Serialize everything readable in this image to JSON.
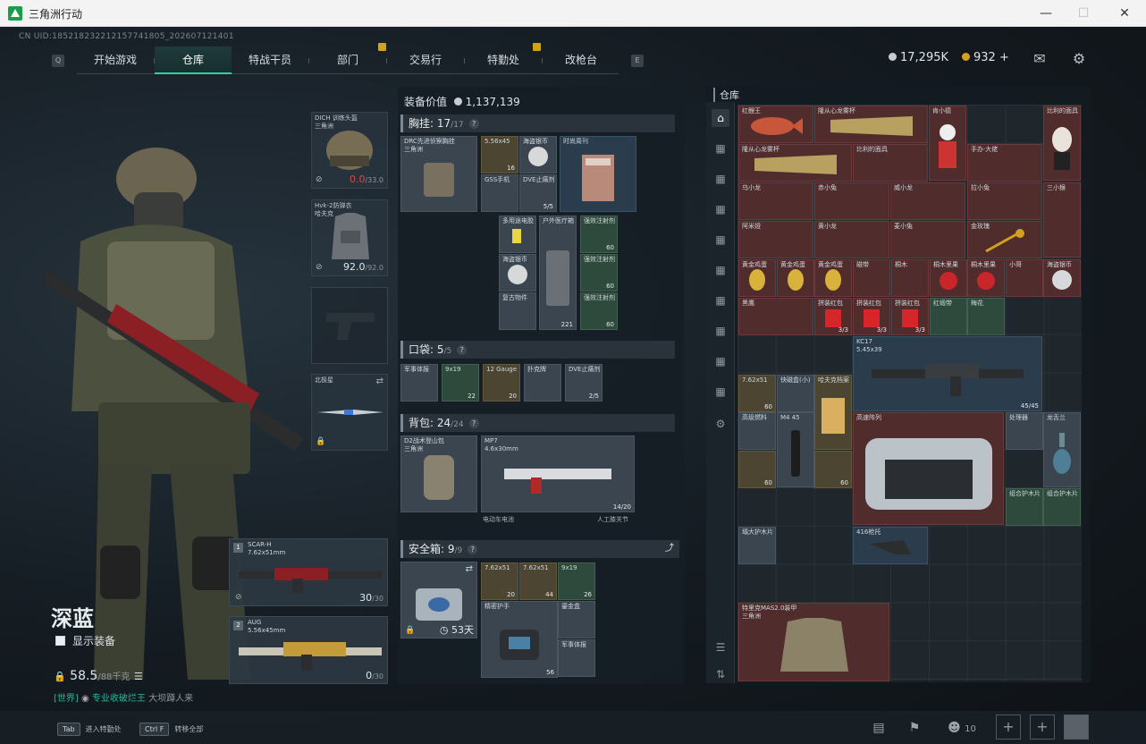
{
  "window": {
    "title": "三角洲行动"
  },
  "uid": "CN UID:185218232212157741805_202607121401",
  "nav": {
    "left_key": "Q",
    "right_key": "E",
    "tabs": [
      {
        "label": "开始游戏"
      },
      {
        "label": "仓库",
        "active": true
      },
      {
        "label": "特战干员"
      },
      {
        "label": "部门"
      },
      {
        "label": "交易行"
      },
      {
        "label": "特勤处"
      },
      {
        "label": "改枪台"
      }
    ]
  },
  "currency": {
    "silver": "17,295K",
    "gold": "932",
    "plus": "+"
  },
  "player": {
    "name": "深蓝",
    "show_equipment": "显示装备",
    "weight": "58.5",
    "weight_max": "/88千克",
    "chat_channel": "[世界]",
    "chat_user": "专业收破烂王",
    "chat_msg": "大坝蹲人来"
  },
  "slots": {
    "helmet": {
      "name": "DICH 训练头盔",
      "sub": "三角洲",
      "durability": "0.0",
      "max": "/33.0"
    },
    "armor": {
      "name": "Hvk-2防弹衣",
      "sub": "哈夫克",
      "durability": "92.0",
      "max": "/92.0"
    },
    "melee": {
      "name": "北极星"
    }
  },
  "weapons": {
    "primary": {
      "num": "1",
      "name": "SCAR-H",
      "caliber": "7.62x51mm",
      "ammo": "30",
      "max": "/30"
    },
    "secondary": {
      "num": "2",
      "name": "AUG",
      "caliber": "5.56x45mm",
      "ammo": "0",
      "max": "/30"
    }
  },
  "equip": {
    "value_label": "装备价值",
    "value": "1,137,139",
    "chest": {
      "label": "胸挂:",
      "count": "17",
      "max": "/17"
    },
    "pocket": {
      "label": "口袋:",
      "count": "5",
      "max": "/5"
    },
    "backpack": {
      "label": "背包:",
      "count": "24",
      "max": "/24"
    },
    "safebox": {
      "label": "安全箱:",
      "count": "9",
      "max": "/9",
      "days": "53天"
    },
    "chest_items": [
      {
        "name": "DRC先进侦察胸挂",
        "sub": "三角洲"
      },
      {
        "name": "5.56x45",
        "count": "16"
      },
      {
        "name": "海盗银币"
      },
      {
        "name": "时尚周刊"
      },
      {
        "name": "GSS手机"
      },
      {
        "name": "DVE止痛剂",
        "count": "5/5"
      }
    ],
    "chest_items2": [
      {
        "name": "多用途电胶"
      },
      {
        "name": "户外医疗箱",
        "count": "221"
      },
      {
        "name": "强效注射剂",
        "count": "60"
      },
      {
        "name": "海盗银币"
      },
      {
        "name": "强效注射剂",
        "count": "60"
      },
      {
        "name": "强效注射剂",
        "count": "60"
      },
      {
        "name": "复古物件"
      }
    ],
    "pocket_items": [
      {
        "name": "军事体报"
      },
      {
        "name": "9x19",
        "count": "22"
      },
      {
        "name": "12 Gauge",
        "count": "20"
      },
      {
        "name": "扑克牌"
      },
      {
        "name": "DVE止痛剂",
        "count": "2/5"
      }
    ],
    "backpack_items": [
      {
        "name": "D2战术登山包",
        "sub": "三角洲"
      },
      {
        "name": "MP7",
        "caliber": "4.6x30mm",
        "count": "14/20"
      },
      {
        "name": "电动车电池"
      },
      {
        "name": "人工膝关节"
      }
    ],
    "safe_items": [
      {
        "name": "7.62x51",
        "count": "20"
      },
      {
        "name": "7.62x51",
        "count": "44"
      },
      {
        "name": "9x19",
        "count": "26"
      },
      {
        "name": "精密护手"
      },
      {
        "name": "鎏金盒",
        "count": "56"
      },
      {
        "name": "军事体报"
      }
    ]
  },
  "stash": {
    "title": "仓库",
    "items": [
      {
        "name": "红鲤王"
      },
      {
        "name": "隆从心龙雾杯"
      },
      {
        "name": "肯小德"
      },
      {
        "name": "比利的面具"
      },
      {
        "name": "隆从心龙雾杯"
      },
      {
        "name": "比利的面具"
      },
      {
        "name": "手办·大佬"
      },
      {
        "name": "乌小龙"
      },
      {
        "name": "赤小兔"
      },
      {
        "name": "威小龙"
      },
      {
        "name": "拉小兔"
      },
      {
        "name": "三小猴"
      },
      {
        "name": "阿米娅"
      },
      {
        "name": "黄小龙"
      },
      {
        "name": "麦小兔"
      },
      {
        "name": "金玫瑰"
      },
      {
        "name": "黄金鸡蛋"
      },
      {
        "name": "黄金鸡蛋"
      },
      {
        "name": "黄金鸡蛋"
      },
      {
        "name": "磁带"
      },
      {
        "name": "桐木"
      },
      {
        "name": "桐木里果"
      },
      {
        "name": "桐木里果"
      },
      {
        "name": "小哥"
      },
      {
        "name": "海盗银币"
      },
      {
        "name": "黑鹰"
      },
      {
        "name": "拼装红包",
        "count": "3/3"
      },
      {
        "name": "拼装红包",
        "count": "3/3"
      },
      {
        "name": "拼装红包",
        "count": "3/3"
      },
      {
        "name": "红缎带"
      },
      {
        "name": "梅花"
      },
      {
        "name": "KC17",
        "caliber": "5.45x39",
        "count": "45/45"
      },
      {
        "name": "7.62x51",
        "count": "60"
      },
      {
        "name": "快磁盒(小)"
      },
      {
        "name": "哈夫克档案"
      },
      {
        "name": "高级燃料"
      },
      {
        "name": "M4 45"
      },
      {
        "name": "高速阵列"
      },
      {
        "name": "处理器"
      },
      {
        "name": "龙舌兰"
      },
      {
        "name": "组合护木片"
      },
      {
        "name": "组合护木片"
      },
      {
        "name": "塌大护木片"
      },
      {
        "name": "416枪托"
      },
      {
        "name": "特里克MAS2.0装甲",
        "sub": "三角洲"
      }
    ]
  },
  "bottom": {
    "tab_key": "Tab",
    "tab_label": "进入特勤处",
    "ctrlf_key": "Ctrl F",
    "ctrlf_label": "转移全部",
    "team_count": "10"
  },
  "colors": {
    "accent": "#2ed3a4",
    "danger": "#e04646",
    "gold": "#d4a21a"
  }
}
